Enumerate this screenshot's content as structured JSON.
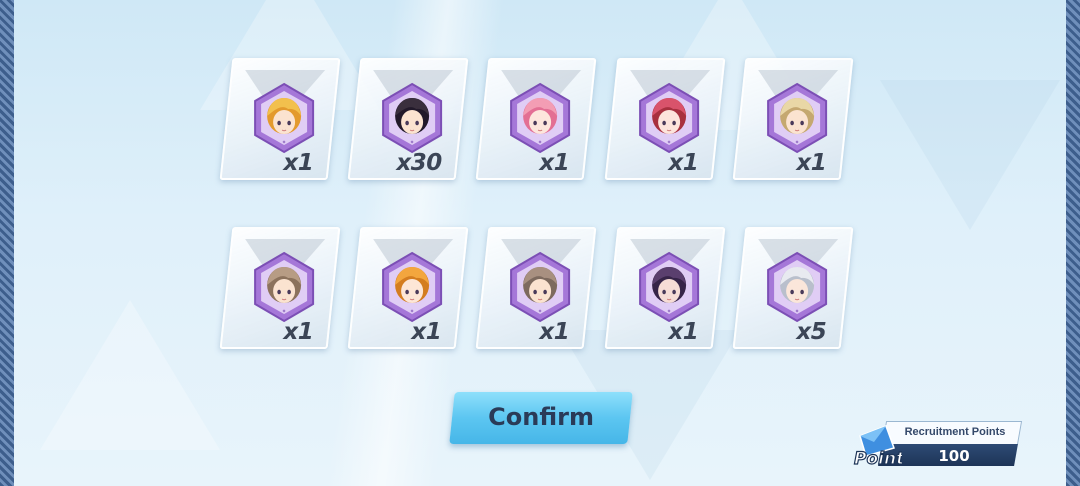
{
  "rewards": [
    {
      "name": "blonde-girl",
      "count": "x1",
      "hair": "#f2c04d",
      "hair2": "#e39a2d",
      "skin": "#fbe3d0"
    },
    {
      "name": "dark-haired-girl",
      "count": "x30",
      "hair": "#3a2f3d",
      "hair2": "#22192a",
      "skin": "#fbe3d0"
    },
    {
      "name": "pink-haired-girl",
      "count": "x1",
      "hair": "#f39db4",
      "hair2": "#e36f94",
      "skin": "#fde6dc"
    },
    {
      "name": "red-haired-girl",
      "count": "x1",
      "hair": "#d9536b",
      "hair2": "#a8303f",
      "skin": "#fde4dc"
    },
    {
      "name": "goggles-girl",
      "count": "x1",
      "hair": "#e9d7a6",
      "hair2": "#c5a870",
      "skin": "#fbe3d0"
    },
    {
      "name": "light-brown-haired-girl",
      "count": "x1",
      "hair": "#b79c84",
      "hair2": "#8c725c",
      "skin": "#fbe3d0"
    },
    {
      "name": "orange-haired-girl",
      "count": "x1",
      "hair": "#f3a63e",
      "hair2": "#d47d20",
      "skin": "#fde6d6"
    },
    {
      "name": "ash-brown-haired-girl",
      "count": "x1",
      "hair": "#a89080",
      "hair2": "#7d6a5e",
      "skin": "#fbe3d0"
    },
    {
      "name": "purple-haired-girl",
      "count": "x1",
      "hair": "#5a3f6e",
      "hair2": "#362448",
      "skin": "#f6dcd6"
    },
    {
      "name": "silver-haired-girl",
      "count": "x5",
      "hair": "#e8eaf0",
      "hair2": "#b9bfcc",
      "skin": "#fbe6da"
    }
  ],
  "confirm_label": "Confirm",
  "points": {
    "label": "Recruitment Points",
    "value": "100",
    "icon_text": "Point"
  },
  "colors": {
    "frame": "#a577d8",
    "frame_inner": "#e0cdf5",
    "accent": "#5cc6f1",
    "count_text": "#3b4556"
  }
}
